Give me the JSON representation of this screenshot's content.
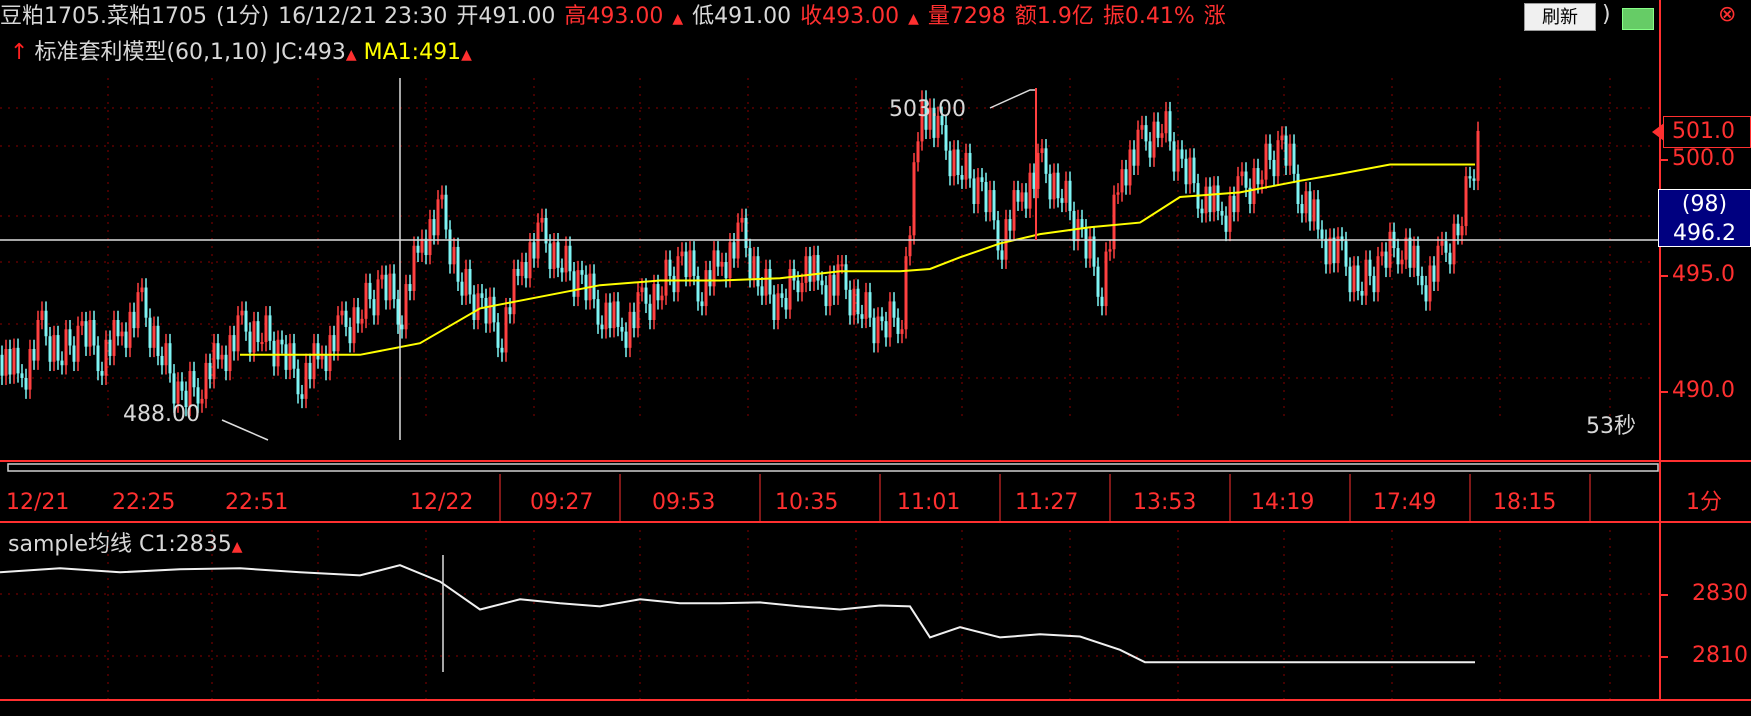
{
  "header": {
    "contract": "豆粕1705.菜粕1705",
    "period": "(1分)",
    "datetime": "16/12/21 23:30",
    "open": "开491.00",
    "high": "高493.00",
    "low": "低491.00",
    "close": "收493.00",
    "volume": "量7298",
    "amount": "额1.9亿",
    "amplitude": "振0.41%",
    "change_prefix": "涨",
    "refresh_label": "刷新",
    "refresh_tail": ")",
    "close_icon": "⊗"
  },
  "indicator": {
    "name": "标准套利模型(60,1,10)",
    "jc": "JC:493",
    "ma1": "MA1:491"
  },
  "chart_labels": {
    "high_marker": "503.00",
    "low_marker": "488.00",
    "countdown": "53秒",
    "last_price": "501.0",
    "cursor_count": "(98)",
    "cursor_price": "496.2",
    "period_label": "1分"
  },
  "colors": {
    "up": "#ff4040",
    "down": "#7ff5f5",
    "ma": "#ffff00",
    "axis": "#ff3030",
    "grid": "#8a0000"
  },
  "chart_data": [
    {
      "type": "line",
      "title": "标准套利模型(60,1,10)",
      "yticks": [
        490.0,
        495.0,
        500.0
      ],
      "ylim": [
        487,
        503.5
      ],
      "x_ticks": [
        "12/21",
        "22:25",
        "22:51",
        "12/22",
        "09:27",
        "09:53",
        "10:35",
        "11:01",
        "11:27",
        "13:53",
        "14:19",
        "17:49",
        "18:15"
      ],
      "series": [
        {
          "name": "JC",
          "x": [
            0,
            20,
            40,
            60,
            80,
            100,
            120,
            140,
            160,
            180,
            200,
            220,
            240,
            260,
            280,
            300,
            320,
            340,
            360,
            380,
            400,
            420,
            440,
            460,
            480,
            500,
            520,
            540,
            560,
            580,
            600,
            620,
            640,
            660,
            680,
            700,
            720,
            740,
            760,
            780,
            800,
            820,
            840,
            860,
            880,
            900,
            920,
            940,
            960,
            980,
            1000,
            1020,
            1040,
            1060,
            1080,
            1100,
            1120,
            1140,
            1160,
            1180,
            1200,
            1220,
            1240,
            1260,
            1280,
            1300,
            1320,
            1340,
            1360,
            1380,
            1400,
            1420,
            1440,
            1460,
            1480
          ],
          "values": [
            491,
            490,
            492,
            491,
            492,
            491,
            492,
            493,
            491,
            489,
            490,
            491,
            492,
            492,
            491,
            490,
            491,
            492,
            493,
            494,
            493,
            496,
            497,
            494,
            493,
            492,
            495,
            496,
            495,
            494,
            493,
            492,
            493,
            494,
            495,
            494,
            495,
            496,
            494,
            493,
            495,
            494,
            494,
            493,
            492,
            493,
            502,
            500,
            499,
            498,
            496,
            498,
            499,
            498,
            496,
            494,
            499,
            500,
            501,
            499,
            498,
            497,
            498,
            499,
            500,
            498,
            496,
            495,
            494,
            495,
            496,
            494,
            495,
            497,
            501
          ]
        },
        {
          "name": "MA1",
          "x": [
            240,
            300,
            360,
            420,
            480,
            540,
            600,
            660,
            720,
            780,
            840,
            900,
            930,
            960,
            1000,
            1040,
            1090,
            1140,
            1180,
            1240,
            1300,
            1340,
            1390,
            1475
          ],
          "values": [
            491,
            491,
            491,
            491.5,
            493,
            493.5,
            494,
            494.2,
            494.2,
            494.3,
            494.6,
            494.6,
            494.7,
            495.2,
            495.8,
            496.2,
            496.5,
            496.7,
            497.8,
            498,
            498.5,
            498.8,
            499.2,
            499.2
          ]
        }
      ],
      "annotations": [
        "503.00",
        "488.00",
        "53秒"
      ]
    },
    {
      "type": "line",
      "title": "sample均线",
      "yticks": [
        2810,
        2830
      ],
      "ylim": [
        2805,
        2845
      ],
      "series": [
        {
          "name": "C1",
          "x": [
            0,
            60,
            120,
            180,
            240,
            300,
            360,
            400,
            440,
            480,
            520,
            560,
            600,
            640,
            680,
            720,
            760,
            800,
            840,
            880,
            910,
            930,
            960,
            1000,
            1040,
            1080,
            1120,
            1145,
            1200,
            1300,
            1400,
            1475
          ],
          "values": [
            2837,
            2837,
            2837,
            2838,
            2837,
            2837,
            2836,
            2838,
            2834,
            2825,
            2827,
            2827,
            2826,
            2827,
            2827,
            2827,
            2826,
            2826,
            2825,
            2825,
            2826,
            2816,
            2818,
            2816,
            2817,
            2815,
            2812,
            2808,
            2808,
            2808,
            2808,
            2808
          ]
        }
      ],
      "legend_value": "C1:2835"
    }
  ]
}
